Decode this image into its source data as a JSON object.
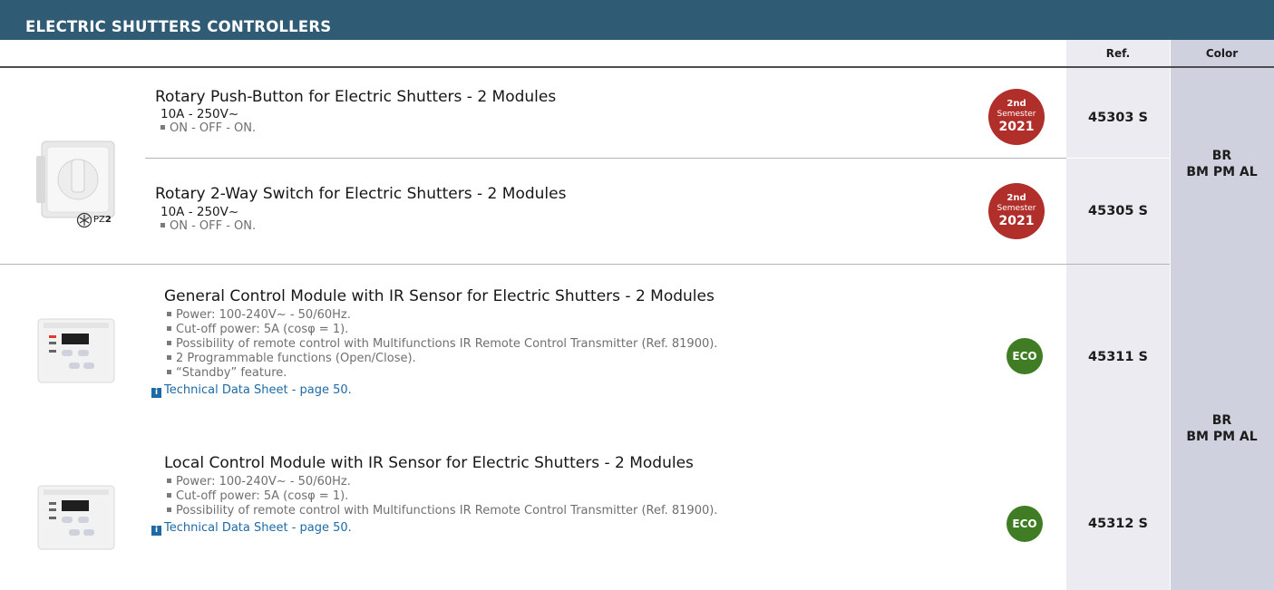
{
  "header": {
    "title": "ELECTRIC SHUTTERS CONTROLLERS"
  },
  "columns": {
    "ref": "Ref.",
    "color": "Color"
  },
  "products": [
    {
      "title": "Rotary Push-Button for Electric Shutters - 2 Modules",
      "spec": "10A - 250V~",
      "bullets": [
        "ON - OFF - ON."
      ],
      "badge": {
        "l1": "2nd",
        "l2": "Semester",
        "l3": "2021"
      },
      "ref": "45303 S"
    },
    {
      "title": "Rotary 2-Way Switch for Electric Shutters - 2 Modules",
      "spec": "10A - 250V~",
      "bullets": [
        "ON - OFF - ON."
      ],
      "badge": {
        "l1": "2nd",
        "l2": "Semester",
        "l3": "2021"
      },
      "ref": "45305 S"
    },
    {
      "title": "General Control Module with IR Sensor for Electric Shutters - 2 Modules",
      "bullets": [
        "Power: 100-240V~ - 50/60Hz.",
        "Cut-off power: 5A (cosφ = 1).",
        "Possibility of remote control with Multifunctions IR Remote Control Transmitter (Ref. 81900).",
        "2 Programmable functions (Open/Close).",
        "“Standby” feature."
      ],
      "link": "Technical Data Sheet - page 50.",
      "badge": {
        "text": "ECO"
      },
      "ref": "45311 S"
    },
    {
      "title": "Local Control Module with IR Sensor for Electric Shutters - 2 Modules",
      "bullets": [
        "Power: 100-240V~ - 50/60Hz.",
        "Cut-off power: 5A (cosφ = 1).",
        "Possibility of remote control with Multifunctions IR Remote Control Transmitter (Ref. 81900)."
      ],
      "link": "Technical Data Sheet - page 50.",
      "badge": {
        "text": "ECO"
      },
      "ref": "45312 S"
    }
  ],
  "groups": [
    {
      "color_line1": "BR",
      "color_line2": "BM PM AL"
    },
    {
      "color_line1": "BR",
      "color_line2": "BM PM AL"
    }
  ],
  "tool_mark": {
    "label": "PZ",
    "num": "2"
  },
  "info_icon": "i",
  "colors": {
    "banner": "#2f5b74",
    "semester_badge": "#b12f2a",
    "eco_badge": "#3f7c23",
    "link": "#1d6aa6"
  }
}
